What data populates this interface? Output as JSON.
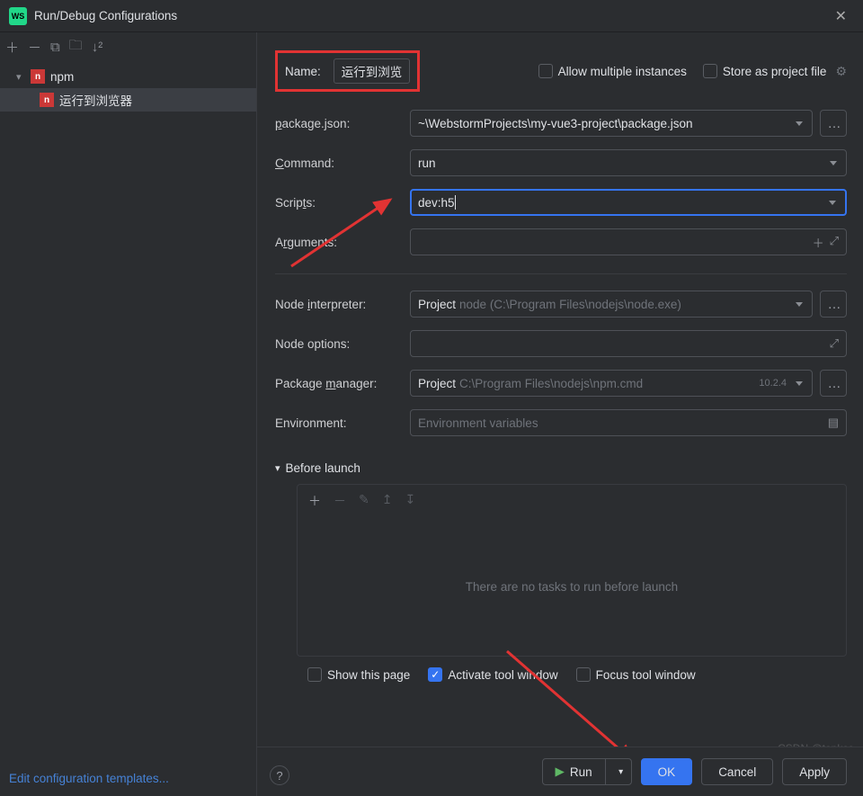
{
  "title": "Run/Debug Configurations",
  "sidebar": {
    "npm_label": "npm",
    "config_label": "运行到浏览器",
    "footer_link": "Edit configuration templates..."
  },
  "form": {
    "name_label": "Name:",
    "name_value": "运行到浏览",
    "allow_multiple": "Allow multiple instances",
    "store_project": "Store as project file",
    "package_label": "package.json:",
    "package_value": "~\\WebstormProjects\\my-vue3-project\\package.json",
    "command_label": "Command:",
    "command_value": "run",
    "scripts_label": "Scripts:",
    "scripts_value": "dev:h5",
    "arguments_label": "Arguments:",
    "node_interp_label": "Node interpreter:",
    "node_interp_prefix": "Project",
    "node_interp_hint": "node (C:\\Program Files\\nodejs\\node.exe)",
    "node_options_label": "Node options:",
    "pkg_mgr_label": "Package manager:",
    "pkg_mgr_prefix": "Project",
    "pkg_mgr_hint": "C:\\Program Files\\nodejs\\npm.cmd",
    "pkg_mgr_version": "10.2.4",
    "env_label": "Environment:",
    "env_placeholder": "Environment variables",
    "before_launch": "Before launch",
    "tasks_empty": "There are no tasks to run before launch",
    "show_page": "Show this page",
    "activate_tool": "Activate tool window",
    "focus_tool": "Focus tool window"
  },
  "buttons": {
    "run": "Run",
    "ok": "OK",
    "cancel": "Cancel",
    "apply": "Apply"
  },
  "watermark": "CSDN @tepkco"
}
